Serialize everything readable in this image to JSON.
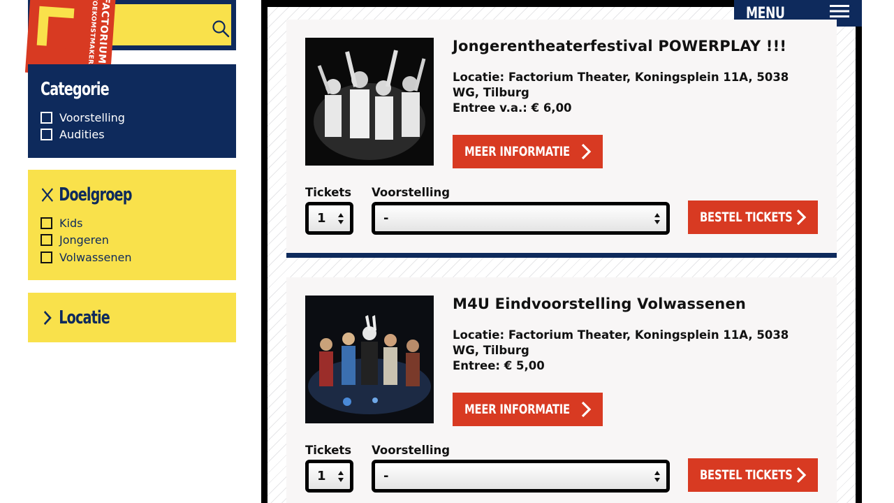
{
  "sidebar": {
    "search": {
      "value": "",
      "placeholder": ""
    },
    "logo": {
      "line1": "FACTORIUM",
      "line2": "TOEKOMSTMAKERS"
    },
    "categorie": {
      "title": "Categorie",
      "items": [
        "Voorstelling",
        "Audities"
      ]
    },
    "doelgroep": {
      "title": "Doelgroep",
      "items": [
        "Kids",
        "Jongeren",
        "Volwassenen"
      ]
    },
    "locatie": {
      "title": "Locatie"
    }
  },
  "header": {
    "menu_label": "MENU"
  },
  "events": [
    {
      "title": "Jongerentheaterfestival POWERPLAY !!!",
      "location": "Locatie: Factorium Theater, Koningsplein 11A, 5038 WG, Tilburg",
      "price": "Entree v.a.: € 6,00",
      "more_info_label": "MEER INFORMATIE",
      "tickets_label": "Tickets",
      "tickets_value": "1",
      "voorstelling_label": "Voorstelling",
      "voorstelling_value": "-",
      "order_label": "BESTEL TICKETS"
    },
    {
      "title": "M4U Eindvoorstelling Volwassenen",
      "location": "Locatie: Factorium Theater, Koningsplein 11A, 5038 WG, Tilburg",
      "price": "Entree: € 5,00",
      "more_info_label": "MEER INFORMATIE",
      "tickets_label": "Tickets",
      "tickets_value": "1",
      "voorstelling_label": "Voorstelling",
      "voorstelling_value": "-",
      "order_label": "BESTEL TICKETS"
    }
  ],
  "colors": {
    "navy": "#0e2a5c",
    "yellow": "#f9e14b",
    "red": "#d83a22",
    "black": "#000000"
  }
}
